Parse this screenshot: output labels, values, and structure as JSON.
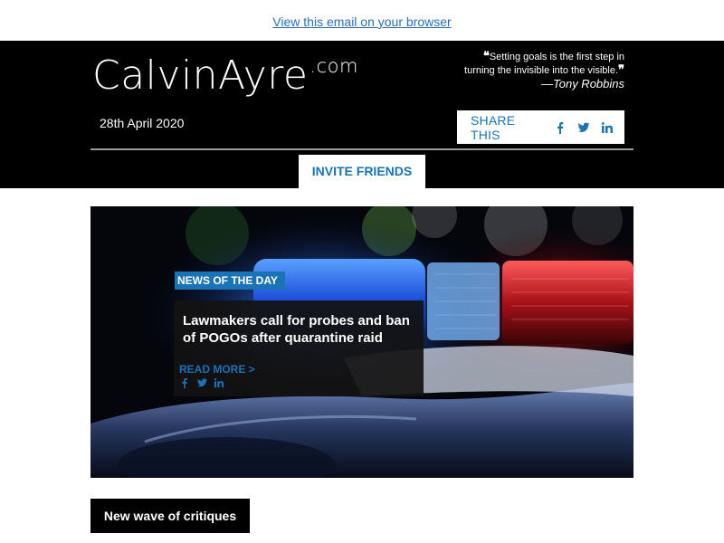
{
  "email": {
    "view_link": "View this email on your browser"
  },
  "header": {
    "logo_main": "CalvinAyre",
    "logo_suffix": ".com",
    "quote_line1": "Setting goals is the first step in",
    "quote_line2": "turning the invisible into the visible.",
    "quote_author": "—Tony Robbins",
    "date": "28th April 2020",
    "share_label": "SHARE THIS",
    "invite_label": "INVITE FRIENDS",
    "share_icons": [
      "facebook-icon",
      "twitter-icon",
      "linkedin-icon"
    ]
  },
  "hero": {
    "tag": "NEWS OF THE DAY",
    "title": "Lawmakers call for probes and ban of POGOs after quarantine raid",
    "read_more": "READ MORE >",
    "social_icons": [
      "facebook-icon",
      "twitter-icon",
      "linkedin-icon"
    ]
  },
  "section": {
    "critiques_label": "New wave of critiques"
  },
  "colors": {
    "accent_blue": "#1a73b5",
    "link_blue": "#2a6ebb",
    "header_bg": "#000000"
  }
}
